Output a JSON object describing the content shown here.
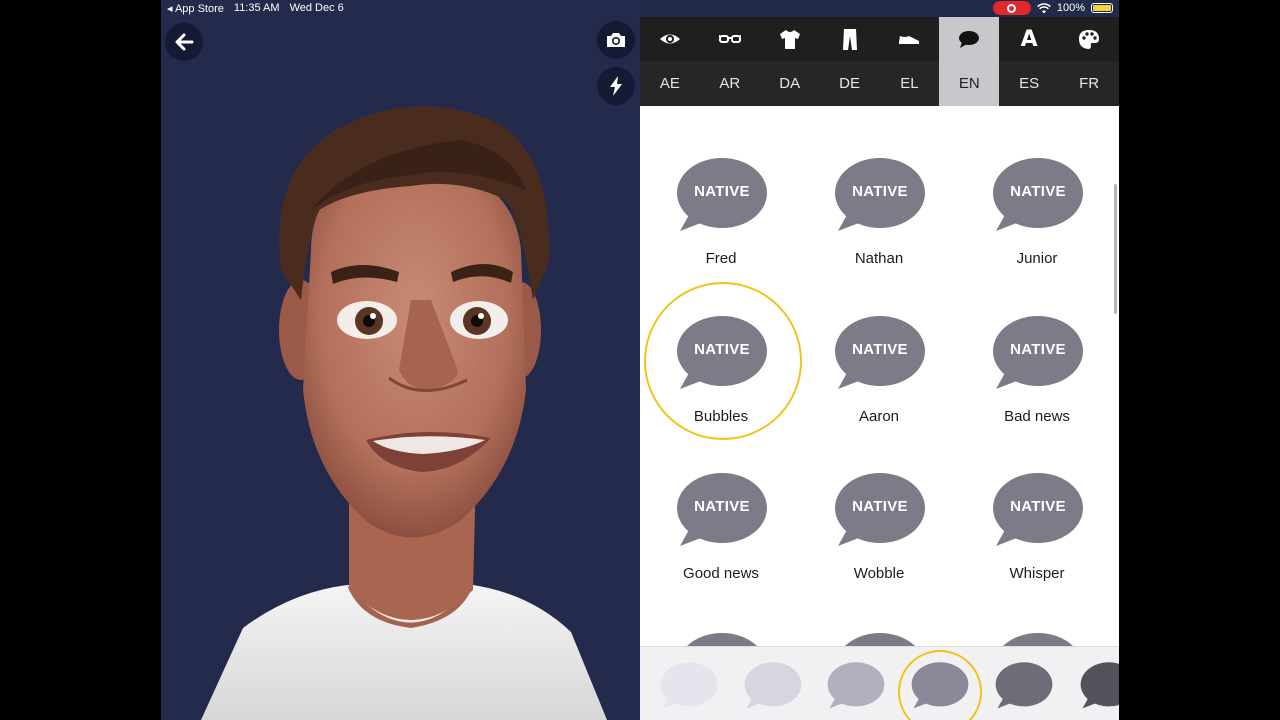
{
  "status": {
    "back_app": "◂ App Store",
    "time": "11:35 AM",
    "date": "Wed Dec 6",
    "battery": "100%",
    "battery_level": 1.0
  },
  "stage": {
    "back_icon": "arrow-left-icon",
    "camera_icon": "camera-icon",
    "lightning_icon": "lightning-icon"
  },
  "toolbar": [
    {
      "icon": "eye-icon",
      "active": false
    },
    {
      "icon": "glasses-icon",
      "active": false
    },
    {
      "icon": "shirt-icon",
      "active": false
    },
    {
      "icon": "pants-icon",
      "active": false
    },
    {
      "icon": "shoe-icon",
      "active": false
    },
    {
      "icon": "speech-bubble-icon",
      "active": true
    },
    {
      "icon": "text-icon",
      "label": "A",
      "active": false
    },
    {
      "icon": "palette-icon",
      "active": false
    }
  ],
  "languages": [
    {
      "code": "AE",
      "active": false
    },
    {
      "code": "AR",
      "active": false
    },
    {
      "code": "DA",
      "active": false
    },
    {
      "code": "DE",
      "active": false
    },
    {
      "code": "EL",
      "active": false
    },
    {
      "code": "EN",
      "active": true
    },
    {
      "code": "ES",
      "active": false
    },
    {
      "code": "FR",
      "active": false
    }
  ],
  "voices": [
    {
      "badge": "NATIVE",
      "name": "Fred",
      "selected": false
    },
    {
      "badge": "NATIVE",
      "name": "Nathan",
      "selected": false
    },
    {
      "badge": "NATIVE",
      "name": "Junior",
      "selected": false
    },
    {
      "badge": "NATIVE",
      "name": "Bubbles",
      "selected": true
    },
    {
      "badge": "NATIVE",
      "name": "Aaron",
      "selected": false
    },
    {
      "badge": "NATIVE",
      "name": "Bad news",
      "selected": false
    },
    {
      "badge": "NATIVE",
      "name": "Good news",
      "selected": false
    },
    {
      "badge": "NATIVE",
      "name": "Wobble",
      "selected": false
    },
    {
      "badge": "NATIVE",
      "name": "Whisper",
      "selected": false
    }
  ],
  "colors": {
    "bubble": "#7e7a88",
    "selection": "#f0c419",
    "swatches": [
      "#e6e5ee",
      "#d7d5df",
      "#b3afbf",
      "#8d8899",
      "#6f6b77",
      "#55525b"
    ],
    "selected_swatch": 3
  }
}
